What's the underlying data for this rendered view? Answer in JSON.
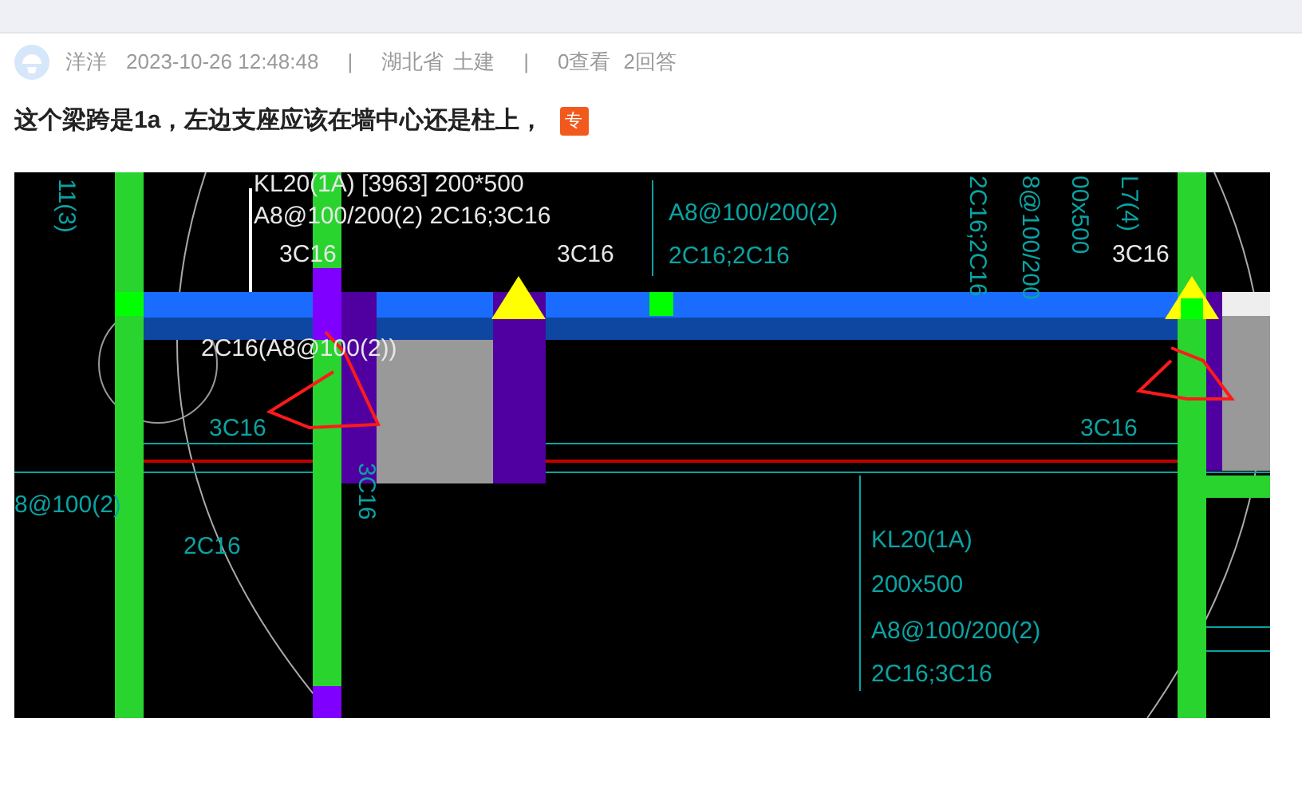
{
  "post": {
    "author": "洋洋",
    "date": "2023-10-26 12:48:48",
    "separator": "|",
    "region": "湖北省",
    "category": "土建",
    "views": "0查看",
    "answers": "2回答",
    "title": "这个梁跨是1a，左边支座应该在墙中心还是柱上，",
    "badge": "专"
  },
  "drawing": {
    "labels": [
      {
        "text": "KL20(1A) [3963] 200*500",
        "kind": "white"
      },
      {
        "text": "A8@100/200(2) 2C16;3C16",
        "kind": "white"
      },
      {
        "text": "3C16",
        "kind": "white"
      },
      {
        "text": "3C16",
        "kind": "white"
      },
      {
        "text": "3C16",
        "kind": "white"
      },
      {
        "text": "2C16(A8@100(2))",
        "kind": "white"
      },
      {
        "text": "3C16",
        "kind": "teal"
      },
      {
        "text": "3C16",
        "kind": "teal"
      },
      {
        "text": "A8@100/200(2)",
        "kind": "teal"
      },
      {
        "text": "2C16;2C16",
        "kind": "teal"
      },
      {
        "text": "KL20(1A)",
        "kind": "teal"
      },
      {
        "text": "200x500",
        "kind": "teal"
      },
      {
        "text": "A8@100/200(2)",
        "kind": "teal"
      },
      {
        "text": "2C16;3C16",
        "kind": "teal"
      },
      {
        "text": "8@100(2)",
        "kind": "teal"
      },
      {
        "text": "2C16",
        "kind": "teal"
      },
      {
        "text": "3C16",
        "kind": "vertical"
      },
      {
        "text": "11(3)",
        "kind": "vertical"
      },
      {
        "text": "2C16;2C16",
        "kind": "vertical"
      },
      {
        "text": "8@100/200",
        "kind": "vertical"
      },
      {
        "text": "00x500",
        "kind": "vertical"
      },
      {
        "text": "L7(4)",
        "kind": "vertical"
      }
    ]
  }
}
